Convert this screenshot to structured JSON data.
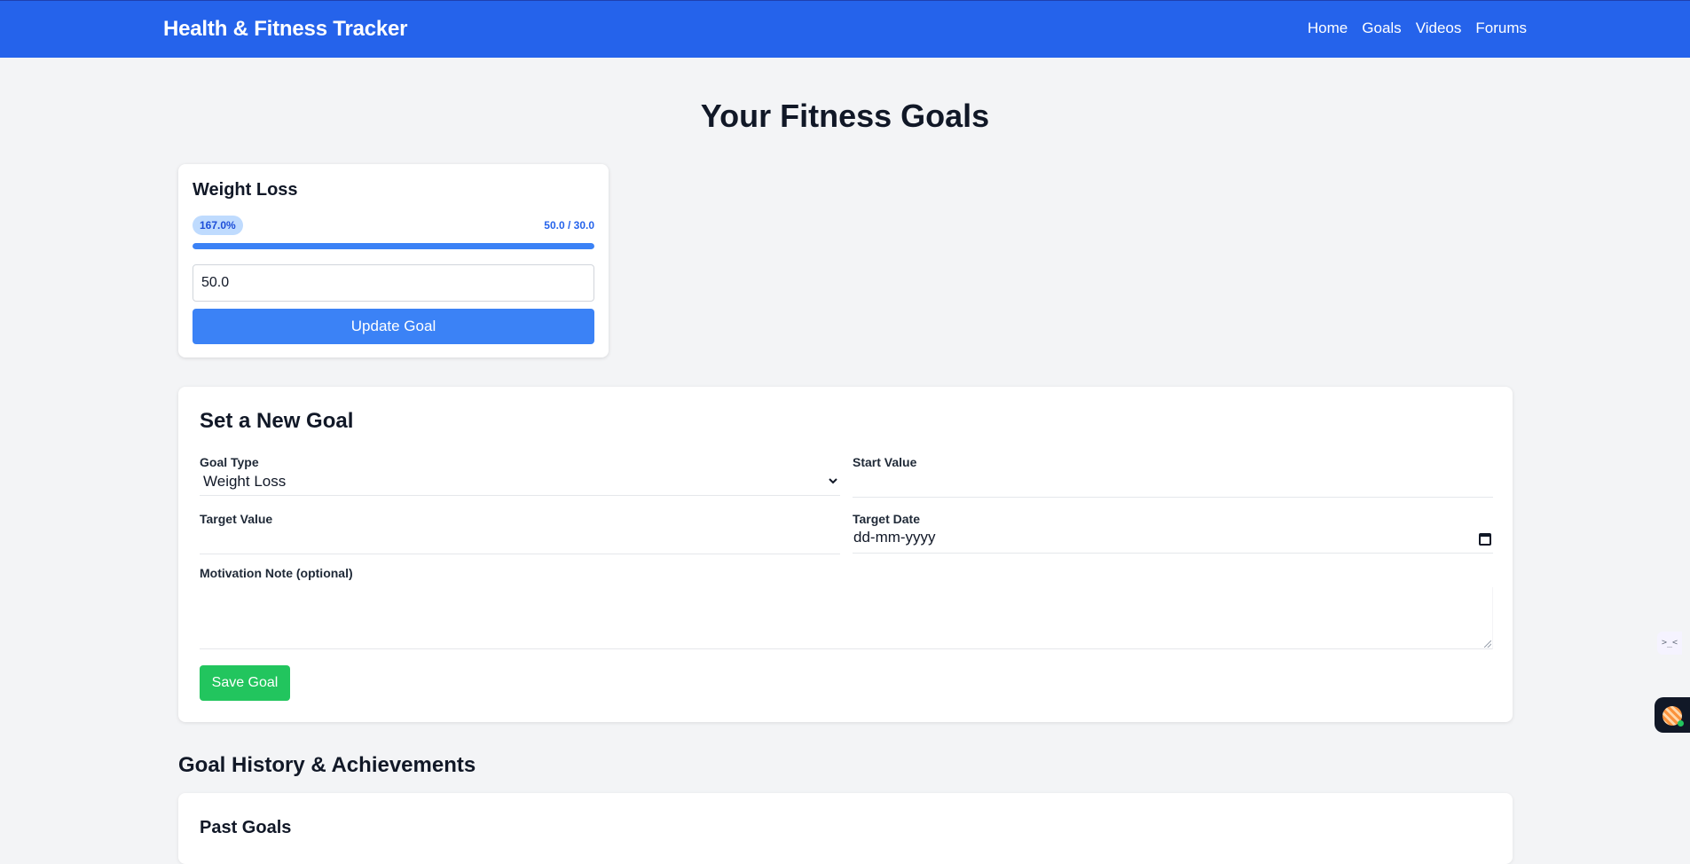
{
  "nav": {
    "brand": "Health & Fitness Tracker",
    "links": [
      "Home",
      "Goals",
      "Videos",
      "Forums"
    ]
  },
  "page": {
    "title": "Your Fitness Goals"
  },
  "goal_card": {
    "title": "Weight Loss",
    "progress_badge": "167.0%",
    "progress_values": "50.0 / 30.0",
    "progress_fraction": 1.0,
    "input_value": "50.0",
    "update_label": "Update Goal"
  },
  "new_goal_form": {
    "title": "Set a New Goal",
    "goal_type_label": "Goal Type",
    "goal_type_value": "Weight Loss",
    "start_value_label": "Start Value",
    "start_value_value": "",
    "target_value_label": "Target Value",
    "target_value_value": "",
    "target_date_label": "Target Date",
    "target_date_placeholder": "dd-mm-yyyy",
    "motivation_label": "Motivation Note (optional)",
    "motivation_value": "",
    "save_label": "Save Goal"
  },
  "history": {
    "title": "Goal History & Achievements",
    "past_goals_title": "Past Goals"
  },
  "floating_widgets": {
    "widget_a_glyph": ">_<"
  },
  "colors": {
    "navbar": "#2563eb",
    "primary_button": "#3b82f6",
    "save_button": "#22c55e",
    "badge_bg": "#bfdbfe",
    "page_bg": "#f3f4f6"
  }
}
